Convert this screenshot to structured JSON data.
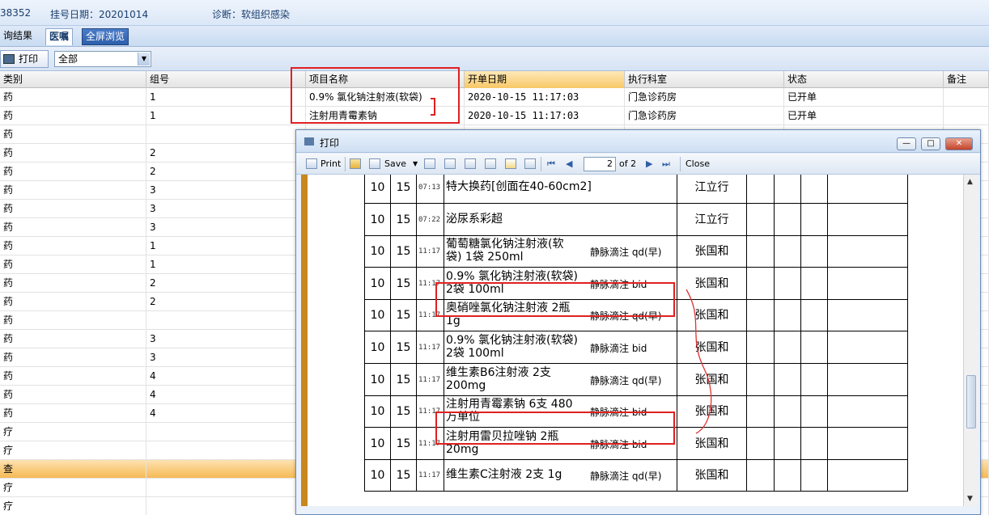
{
  "header": {
    "patient_id": "38352",
    "reg_date": "挂号日期：20201014",
    "diagnosis": "诊断：软组织感染"
  },
  "tabs": [
    {
      "label": "询结果"
    },
    {
      "label": "医嘱"
    },
    {
      "label": "全屏浏览"
    }
  ],
  "toolbar": {
    "print_label": "打印",
    "filter_value": "全部"
  },
  "grid": {
    "columns": [
      "类别",
      "组号",
      "项目名称",
      "开单日期",
      "执行科室",
      "状态",
      "备注"
    ],
    "rows": [
      {
        "type": "药",
        "group": "1",
        "item": "0.9% 氯化钠注射液(软袋)",
        "date": "2020-10-15 11:17:03",
        "dept": "门急诊药房",
        "status": "已开单"
      },
      {
        "type": "药",
        "group": "1",
        "item": "注射用青霉素钠",
        "date": "2020-10-15 11:17:03",
        "dept": "门急诊药房",
        "status": "已开单"
      },
      {
        "type": "药",
        "group": "",
        "item": "",
        "date": "",
        "dept": "",
        "status": ""
      },
      {
        "type": "药",
        "group": "2",
        "item": "",
        "date": "",
        "dept": "",
        "status": ""
      },
      {
        "type": "药",
        "group": "2",
        "item": "",
        "date": "",
        "dept": "",
        "status": ""
      },
      {
        "type": "药",
        "group": "3",
        "item": "",
        "date": "",
        "dept": "",
        "status": ""
      },
      {
        "type": "药",
        "group": "3",
        "item": "",
        "date": "",
        "dept": "",
        "status": ""
      },
      {
        "type": "药",
        "group": "3",
        "item": "",
        "date": "",
        "dept": "",
        "status": ""
      },
      {
        "type": "药",
        "group": "1",
        "item": "",
        "date": "",
        "dept": "",
        "status": ""
      },
      {
        "type": "药",
        "group": "1",
        "item": "",
        "date": "",
        "dept": "",
        "status": ""
      },
      {
        "type": "药",
        "group": "2",
        "item": "",
        "date": "",
        "dept": "",
        "status": ""
      },
      {
        "type": "药",
        "group": "2",
        "item": "",
        "date": "",
        "dept": "",
        "status": ""
      },
      {
        "type": "药",
        "group": "",
        "item": "",
        "date": "",
        "dept": "",
        "status": ""
      },
      {
        "type": "药",
        "group": "3",
        "item": "",
        "date": "",
        "dept": "",
        "status": ""
      },
      {
        "type": "药",
        "group": "3",
        "item": "",
        "date": "",
        "dept": "",
        "status": ""
      },
      {
        "type": "药",
        "group": "4",
        "item": "",
        "date": "",
        "dept": "",
        "status": ""
      },
      {
        "type": "药",
        "group": "4",
        "item": "",
        "date": "",
        "dept": "",
        "status": ""
      },
      {
        "type": "药",
        "group": "4",
        "item": "",
        "date": "",
        "dept": "",
        "status": ""
      },
      {
        "type": "疗",
        "group": "",
        "item": "",
        "date": "",
        "dept": "",
        "status": ""
      },
      {
        "type": "疗",
        "group": "",
        "item": "",
        "date": "",
        "dept": "",
        "status": ""
      },
      {
        "type": "查",
        "group": "",
        "item": "",
        "date": "",
        "dept": "",
        "status": "",
        "highlight": true
      },
      {
        "type": "疗",
        "group": "",
        "item": "",
        "date": "",
        "dept": "",
        "status": ""
      },
      {
        "type": "疗",
        "group": "",
        "item": "",
        "date": "",
        "dept": "",
        "status": ""
      }
    ]
  },
  "dialog": {
    "title": "打印",
    "print_label": "Print",
    "save_label": "Save",
    "page_value": "2",
    "page_total": "of 2",
    "close_label": "Close",
    "report_rows": [
      {
        "c1": "10",
        "c2": "15",
        "time": "07:13",
        "line1": "特大换药[创面在40-60cm2]",
        "line2": "",
        "usage": "",
        "person": "江立行"
      },
      {
        "c1": "10",
        "c2": "15",
        "time": "07:22",
        "line1": "泌尿系彩超",
        "line2": "",
        "usage": "",
        "person": "江立行"
      },
      {
        "c1": "10",
        "c2": "15",
        "time": "11:17",
        "line1": "葡萄糖氯化钠注射液(软",
        "line2": "袋) 1袋    250ml",
        "usage": "静脉滴注 qd(早)",
        "person": "张国和"
      },
      {
        "c1": "10",
        "c2": "15",
        "time": "11:17",
        "line1": "0.9% 氯化钠注射液(软袋)",
        "line2": "2袋    100ml",
        "usage": "静脉滴注 bid",
        "person": "张国和"
      },
      {
        "c1": "10",
        "c2": "15",
        "time": "11:17",
        "line1": "奥硝唑氯化钠注射液 2瓶",
        "line2": "1g",
        "usage": "静脉滴注 qd(早)",
        "person": "张国和"
      },
      {
        "c1": "10",
        "c2": "15",
        "time": "11:17",
        "line1": "0.9% 氯化钠注射液(软袋)",
        "line2": "2袋    100ml",
        "usage": "静脉滴注 bid",
        "person": "张国和"
      },
      {
        "c1": "10",
        "c2": "15",
        "time": "11:17",
        "line1": "维生素B6注射液 2支",
        "line2": "200mg",
        "usage": "静脉滴注 qd(早)",
        "person": "张国和"
      },
      {
        "c1": "10",
        "c2": "15",
        "time": "11:17",
        "line1": "注射用青霉素钠 6支    480",
        "line2": "万单位",
        "usage": "静脉滴注 bid",
        "person": "张国和"
      },
      {
        "c1": "10",
        "c2": "15",
        "time": "11:17",
        "line1": "注射用雷贝拉唑钠 2瓶",
        "line2": "20mg",
        "usage": "静脉滴注 bid",
        "person": "张国和"
      },
      {
        "c1": "10",
        "c2": "15",
        "time": "11:17",
        "line1": "维生素C注射液 2支    1g",
        "line2": "",
        "usage": "静脉滴注 qd(早)",
        "person": "张国和"
      }
    ]
  }
}
